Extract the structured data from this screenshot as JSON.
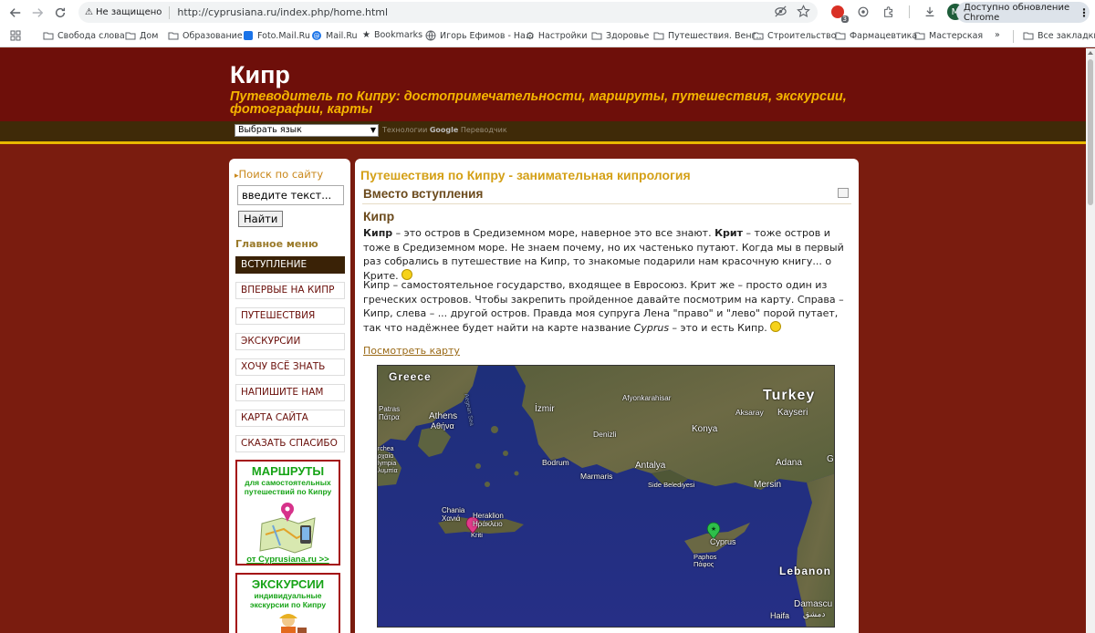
{
  "browser": {
    "security_label": "Не защищено",
    "url": "http://cyprusiana.ru/index.php/home.html",
    "avatar_letter": "M",
    "update_label": "Доступно обновление Chrome"
  },
  "bookmarks": [
    "Свобода слова",
    "Дом",
    "Образование",
    "Foto.Mail.Ru",
    "Mail.Ru",
    "Bookmarks",
    "Игорь Ефимов - На...",
    "Настройки",
    "Здоровье",
    "Путешествия. Венг...",
    "Строительство",
    "Фармацевтика",
    "Мастерская"
  ],
  "bookmarks_more": "»",
  "bookmarks_all": "Все закладки",
  "site": {
    "title": "Кипр",
    "tagline": "Путеводитель по Кипру: достопримечательности, маршруты, путешествия, экскурсии, фотографии, карты",
    "language_select": "Выбрать язык",
    "powered_prefix": "Технологии",
    "powered_brand": "Google",
    "powered_suffix": "Переводчик"
  },
  "sidebar": {
    "search_title": "Поиск по сайту",
    "search_input_value": "введите текст...",
    "search_button": "Найти",
    "menu_title": "Главное меню",
    "menu_items": [
      "ВСТУПЛЕНИЕ",
      "ВПЕРВЫЕ НА КИПР",
      "ПУТЕШЕСТВИЯ",
      "ЭКСКУРСИИ",
      "ХОЧУ ВСЁ ЗНАТЬ",
      "НАПИШИТЕ НАМ",
      "КАРТА САЙТА",
      "СКАЗАТЬ СПАСИБО"
    ],
    "active_index": 0,
    "promo_routes": {
      "title": "МАРШРУТЫ",
      "subtitle": "для самостоятельных путешествий по Кипру",
      "link": "от Cyprusiana.ru >>"
    },
    "promo_excursions": {
      "title": "ЭКСКУРСИИ",
      "subtitle": "индивидуальные экскурсии по Кипру"
    }
  },
  "main": {
    "title": "Путешествия по Кипру - занимательная кипрология",
    "section_title": "Вместо вступления",
    "subtitle": "Кипр",
    "p1_bold1": "Кипр",
    "p1_text1": " – это остров в Средиземном море, наверное это все знают. ",
    "p1_bold2": "Крит",
    "p1_text2": " – тоже остров и тоже в Средиземном море. Не знаем почему, но их частенько путают. Когда мы в первый раз собрались в путешествие на Кипр, то знакомые подарили нам красочную книгу... о Крите. ",
    "p2_text1": "Кипр – самостоятельное государство, входящее в Евросоюз. Крит же – просто один из греческих островов. Чтобы закрепить пройденное давайте посмотрим на карту. Справа – Кипр, слева – ... другой остров. Правда моя супруга Лена \"право\" и \"лево\" порой путает, так что надёжнее будет найти на карте название ",
    "p2_italic": "Cyprus",
    "p2_text2": " – это и есть Кипр. ",
    "map_link": "Посмотреть карту"
  },
  "map_labels": {
    "greece": "Greece",
    "turkey": "Turkey",
    "athens": "Athens",
    "athens_gr": "Αθήνα",
    "izmir": "İzmir",
    "afyon": "Afyonkarahisar",
    "aksaray": "Aksaray",
    "kayseri": "Kayseri",
    "konya": "Konya",
    "denizli": "Denizli",
    "antalya": "Antalya",
    "side": "Side Belediyesi",
    "adana": "Adana",
    "mersin": "Mersin",
    "bodrum": "Bodrum",
    "marmaris": "Marmaris",
    "patras": "Patras",
    "patras_gr": "Πάτρα",
    "chania": "Chania",
    "chania_gr": "Χανιά",
    "heraklion": "Heraklion",
    "heraklion_gr": "Ηράκλειο",
    "kriti": "Kriti",
    "cyprus": "Cyprus",
    "paphos": "Paphos",
    "paphos_gr": "Πάφος",
    "lebanon": "Lebanon",
    "damascus": "Damascu",
    "damascus_ar": "دمشق",
    "haifa": "Haifa",
    "aegean": "Aegean Sea",
    "g": "G",
    "archea": "rchea",
    "archea_gr": "ρχαία",
    "olympia": "lympia",
    "olympia_gr": "λυμπία"
  },
  "colors": {
    "header_bg": "#6e0f0a",
    "tagline": "#f5b400",
    "page_bg": "#7a1c0f",
    "accent_gold": "#d4a017",
    "active_menu": "#3a2206"
  }
}
